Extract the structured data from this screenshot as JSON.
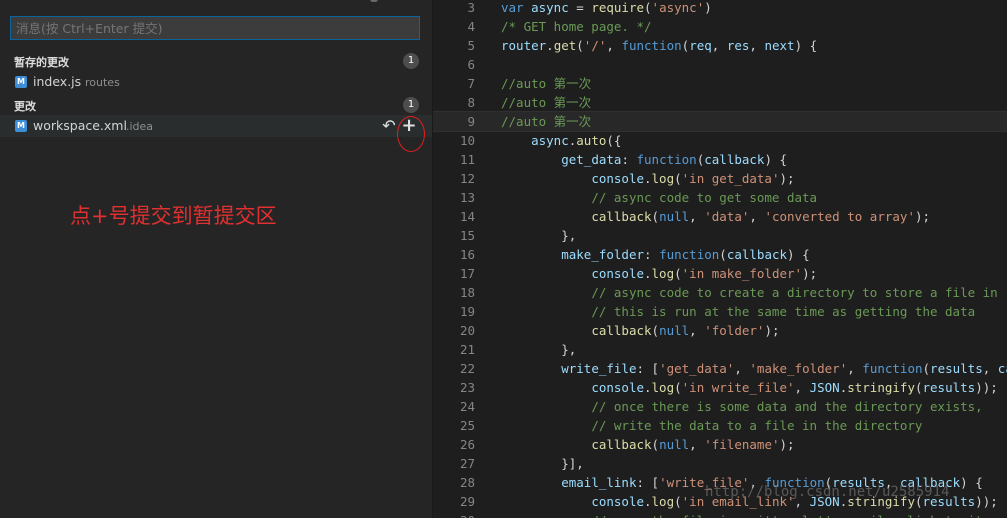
{
  "scm": {
    "message_placeholder": "消息(按 Ctrl+Enter 提交)",
    "staged": {
      "label": "暂存的更改",
      "count": "1",
      "files": [
        {
          "icon": "M",
          "name": "index.js",
          "dir": "routes"
        }
      ]
    },
    "changes": {
      "label": "更改",
      "count": "1",
      "files": [
        {
          "icon": "M",
          "name": "workspace.xml",
          "dir": ".idea",
          "discard_glyph": "↶",
          "stage_glyph": "+"
        }
      ]
    }
  },
  "annotation": {
    "text": "点+号提交到暂提交区",
    "color": "#e03030"
  },
  "editor": {
    "current_line": "9",
    "lines": [
      {
        "n": "3",
        "t": [
          [
            "k",
            "var "
          ],
          [
            "v",
            "async"
          ],
          [
            "p",
            " = "
          ],
          [
            "f",
            "require"
          ],
          [
            "p",
            "("
          ],
          [
            "s",
            "'async'"
          ],
          [
            "p",
            ")"
          ]
        ]
      },
      {
        "n": "4",
        "t": [
          [
            "c",
            "/* GET home page. */"
          ]
        ]
      },
      {
        "n": "5",
        "t": [
          [
            "v",
            "router"
          ],
          [
            "p",
            "."
          ],
          [
            "f",
            "get"
          ],
          [
            "p",
            "("
          ],
          [
            "s",
            "'/'"
          ],
          [
            "p",
            ", "
          ],
          [
            "k",
            "function"
          ],
          [
            "p",
            "("
          ],
          [
            "v",
            "req"
          ],
          [
            "p",
            ", "
          ],
          [
            "v",
            "res"
          ],
          [
            "p",
            ", "
          ],
          [
            "v",
            "next"
          ],
          [
            "p",
            ") {"
          ]
        ]
      },
      {
        "n": "6",
        "t": []
      },
      {
        "n": "7",
        "t": [
          [
            "c",
            "//auto 第一次"
          ]
        ]
      },
      {
        "n": "8",
        "t": [
          [
            "c",
            "//auto 第一次"
          ]
        ]
      },
      {
        "n": "9",
        "t": [
          [
            "c",
            "//auto 第一次"
          ]
        ]
      },
      {
        "n": "10",
        "t": [
          [
            "p",
            "    "
          ],
          [
            "v",
            "async"
          ],
          [
            "p",
            "."
          ],
          [
            "f",
            "auto"
          ],
          [
            "p",
            "({"
          ]
        ]
      },
      {
        "n": "11",
        "t": [
          [
            "p",
            "        "
          ],
          [
            "v",
            "get_data"
          ],
          [
            "p",
            ": "
          ],
          [
            "k",
            "function"
          ],
          [
            "p",
            "("
          ],
          [
            "v",
            "callback"
          ],
          [
            "p",
            ") {"
          ]
        ]
      },
      {
        "n": "12",
        "t": [
          [
            "p",
            "            "
          ],
          [
            "v",
            "console"
          ],
          [
            "p",
            "."
          ],
          [
            "f",
            "log"
          ],
          [
            "p",
            "("
          ],
          [
            "s",
            "'in get_data'"
          ],
          [
            "p",
            ");"
          ]
        ]
      },
      {
        "n": "13",
        "t": [
          [
            "p",
            "            "
          ],
          [
            "c",
            "// async code to get some data"
          ]
        ]
      },
      {
        "n": "14",
        "t": [
          [
            "p",
            "            "
          ],
          [
            "f",
            "callback"
          ],
          [
            "p",
            "("
          ],
          [
            "k",
            "null"
          ],
          [
            "p",
            ", "
          ],
          [
            "s",
            "'data'"
          ],
          [
            "p",
            ", "
          ],
          [
            "s",
            "'converted to array'"
          ],
          [
            "p",
            ");"
          ]
        ]
      },
      {
        "n": "15",
        "t": [
          [
            "p",
            "        },"
          ]
        ]
      },
      {
        "n": "16",
        "t": [
          [
            "p",
            "        "
          ],
          [
            "v",
            "make_folder"
          ],
          [
            "p",
            ": "
          ],
          [
            "k",
            "function"
          ],
          [
            "p",
            "("
          ],
          [
            "v",
            "callback"
          ],
          [
            "p",
            ") {"
          ]
        ]
      },
      {
        "n": "17",
        "t": [
          [
            "p",
            "            "
          ],
          [
            "v",
            "console"
          ],
          [
            "p",
            "."
          ],
          [
            "f",
            "log"
          ],
          [
            "p",
            "("
          ],
          [
            "s",
            "'in make_folder'"
          ],
          [
            "p",
            ");"
          ]
        ]
      },
      {
        "n": "18",
        "t": [
          [
            "p",
            "            "
          ],
          [
            "c",
            "// async code to create a directory to store a file in"
          ]
        ]
      },
      {
        "n": "19",
        "t": [
          [
            "p",
            "            "
          ],
          [
            "c",
            "// this is run at the same time as getting the data"
          ]
        ]
      },
      {
        "n": "20",
        "t": [
          [
            "p",
            "            "
          ],
          [
            "f",
            "callback"
          ],
          [
            "p",
            "("
          ],
          [
            "k",
            "null"
          ],
          [
            "p",
            ", "
          ],
          [
            "s",
            "'folder'"
          ],
          [
            "p",
            ");"
          ]
        ]
      },
      {
        "n": "21",
        "t": [
          [
            "p",
            "        },"
          ]
        ]
      },
      {
        "n": "22",
        "t": [
          [
            "p",
            "        "
          ],
          [
            "v",
            "write_file"
          ],
          [
            "p",
            ": ["
          ],
          [
            "s",
            "'get_data'"
          ],
          [
            "p",
            ", "
          ],
          [
            "s",
            "'make_folder'"
          ],
          [
            "p",
            ", "
          ],
          [
            "k",
            "function"
          ],
          [
            "p",
            "("
          ],
          [
            "v",
            "results"
          ],
          [
            "p",
            ", "
          ],
          [
            "v",
            "callback"
          ],
          [
            "p",
            ") {"
          ]
        ]
      },
      {
        "n": "23",
        "t": [
          [
            "p",
            "            "
          ],
          [
            "v",
            "console"
          ],
          [
            "p",
            "."
          ],
          [
            "f",
            "log"
          ],
          [
            "p",
            "("
          ],
          [
            "s",
            "'in write_file'"
          ],
          [
            "p",
            ", "
          ],
          [
            "v",
            "JSON"
          ],
          [
            "p",
            "."
          ],
          [
            "f",
            "stringify"
          ],
          [
            "p",
            "("
          ],
          [
            "v",
            "results"
          ],
          [
            "p",
            "));"
          ]
        ]
      },
      {
        "n": "24",
        "t": [
          [
            "p",
            "            "
          ],
          [
            "c",
            "// once there is some data and the directory exists,"
          ]
        ]
      },
      {
        "n": "25",
        "t": [
          [
            "p",
            "            "
          ],
          [
            "c",
            "// write the data to a file in the directory"
          ]
        ]
      },
      {
        "n": "26",
        "t": [
          [
            "p",
            "            "
          ],
          [
            "f",
            "callback"
          ],
          [
            "p",
            "("
          ],
          [
            "k",
            "null"
          ],
          [
            "p",
            ", "
          ],
          [
            "s",
            "'filename'"
          ],
          [
            "p",
            ");"
          ]
        ]
      },
      {
        "n": "27",
        "t": [
          [
            "p",
            "        }],"
          ]
        ]
      },
      {
        "n": "28",
        "t": [
          [
            "p",
            "        "
          ],
          [
            "v",
            "email_link"
          ],
          [
            "p",
            ": ["
          ],
          [
            "s",
            "'write_file'"
          ],
          [
            "p",
            ", "
          ],
          [
            "k",
            "function"
          ],
          [
            "p",
            "("
          ],
          [
            "v",
            "results"
          ],
          [
            "p",
            ", "
          ],
          [
            "v",
            "callback"
          ],
          [
            "p",
            ") {"
          ]
        ]
      },
      {
        "n": "29",
        "t": [
          [
            "p",
            "            "
          ],
          [
            "v",
            "console"
          ],
          [
            "p",
            "."
          ],
          [
            "f",
            "log"
          ],
          [
            "p",
            "("
          ],
          [
            "s",
            "'in email_link'"
          ],
          [
            "p",
            ", "
          ],
          [
            "v",
            "JSON"
          ],
          [
            "p",
            "."
          ],
          [
            "f",
            "stringify"
          ],
          [
            "p",
            "("
          ],
          [
            "v",
            "results"
          ],
          [
            "p",
            "));"
          ]
        ]
      },
      {
        "n": "30",
        "t": [
          [
            "p",
            "            "
          ],
          [
            "c",
            "// once the file is written let's email a link to it..."
          ]
        ]
      }
    ]
  },
  "watermark": "http://blog.csdn.net/u2585914"
}
